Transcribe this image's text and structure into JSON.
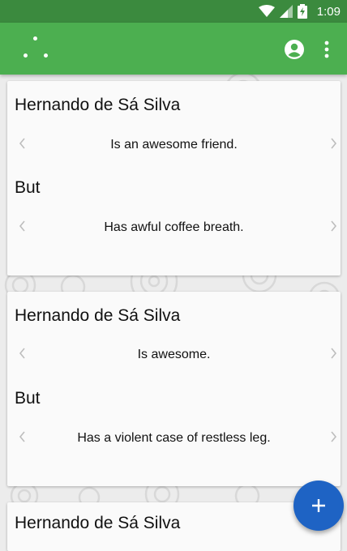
{
  "status_bar": {
    "time": "1:09"
  },
  "app_bar": {
    "account_icon": "account-circle-icon",
    "menu_icon": "more-vert-icon",
    "logo_icon": "three-dots-logo-icon"
  },
  "colors": {
    "status_bar": "#3b8a3e",
    "app_bar": "#4caf50",
    "fab": "#1e63c4"
  },
  "cards": [
    {
      "name": "Hernando de Sá Silva",
      "positive": "Is an awesome friend.",
      "connector": "But",
      "negative": "Has awful coffee breath."
    },
    {
      "name": "Hernando de Sá Silva",
      "positive": "Is awesome.",
      "connector": "But",
      "negative": "Has a violent case of restless leg."
    },
    {
      "name": "Hernando de Sá Silva"
    }
  ],
  "fab": {
    "icon": "plus-icon"
  }
}
